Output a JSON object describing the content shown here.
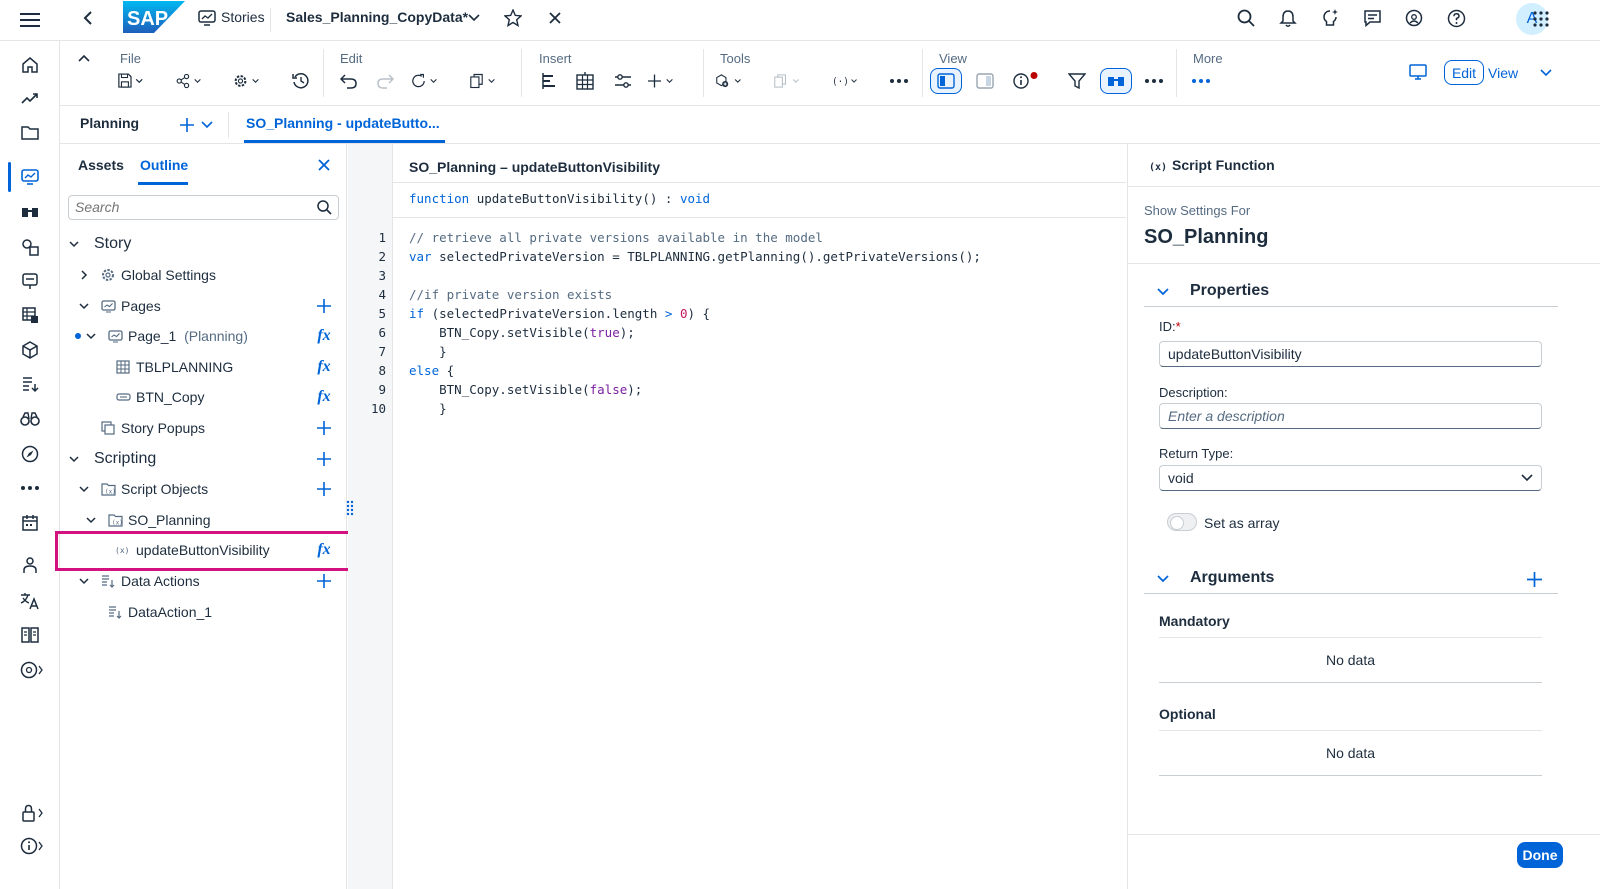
{
  "shell": {
    "logo_text": "SAP",
    "stories_label": "Stories",
    "story_title": "Sales_Planning_CopyData",
    "dirty_marker": "*",
    "avatar_initial": "A"
  },
  "toolbar": {
    "groups": {
      "file": "File",
      "edit": "Edit",
      "insert": "Insert",
      "tools": "Tools",
      "view": "View",
      "more": "More"
    },
    "edit_button": "Edit",
    "view_button": "View"
  },
  "tabs": {
    "planning": "Planning",
    "script_tab": "SO_Planning - updateButto..."
  },
  "side_panel": {
    "tab_assets": "Assets",
    "tab_outline": "Outline",
    "search_placeholder": "Search",
    "tree": {
      "story": "Story",
      "global_settings": "Global Settings",
      "pages": "Pages",
      "page1": "Page_1",
      "page1_sub": "(Planning)",
      "tblplanning": "TBLPLANNING",
      "btn_copy": "BTN_Copy",
      "story_popups": "Story Popups",
      "scripting": "Scripting",
      "script_objects": "Script Objects",
      "so_planning": "SO_Planning",
      "update_fn": "updateButtonVisibility",
      "data_actions": "Data Actions",
      "data_action_1": "DataAction_1"
    },
    "fx_symbol": "fx"
  },
  "editor": {
    "title": "SO_Planning – updateButtonVisibility",
    "sig_keyword": "function",
    "sig_name": "updateButtonVisibility() :",
    "sig_type": "void",
    "line_numbers": [
      "1",
      "2",
      "3",
      "4",
      "5",
      "6",
      "7",
      "8",
      "9",
      "10"
    ],
    "code": {
      "l1": "// retrieve all private versions available in the model",
      "l2_kw": "var",
      "l2_rest": " selectedPrivateVersion = TBLPLANNING.getPlanning().getPrivateVersions();",
      "l4": "//if private version exists",
      "l5_kw": "if",
      "l5_a": " (selectedPrivateVersion.length ",
      "l5_op": ">",
      "l5_b": " ",
      "l5_num": "0",
      "l5_c": ") {",
      "l6_a": "    BTN_Copy.setVisible(",
      "l6_bool": "true",
      "l6_c": ");",
      "l7": "    }",
      "l8_kw": "else",
      "l8_rest": " {",
      "l9_a": "    BTN_Copy.setVisible(",
      "l9_bool": "false",
      "l9_c": ");",
      "l10": "    }"
    }
  },
  "right_panel": {
    "title": "Script Function",
    "show_settings_for": "Show Settings For",
    "object_name": "SO_Planning",
    "properties": "Properties",
    "id_label": "ID:",
    "id_required": "*",
    "id_value": "updateButtonVisibility",
    "description_label": "Description:",
    "description_placeholder": "Enter a description",
    "return_type_label": "Return Type:",
    "return_type_value": "void",
    "set_as_array": "Set as array",
    "arguments": "Arguments",
    "mandatory": "Mandatory",
    "optional": "Optional",
    "no_data": "No data",
    "done": "Done"
  }
}
